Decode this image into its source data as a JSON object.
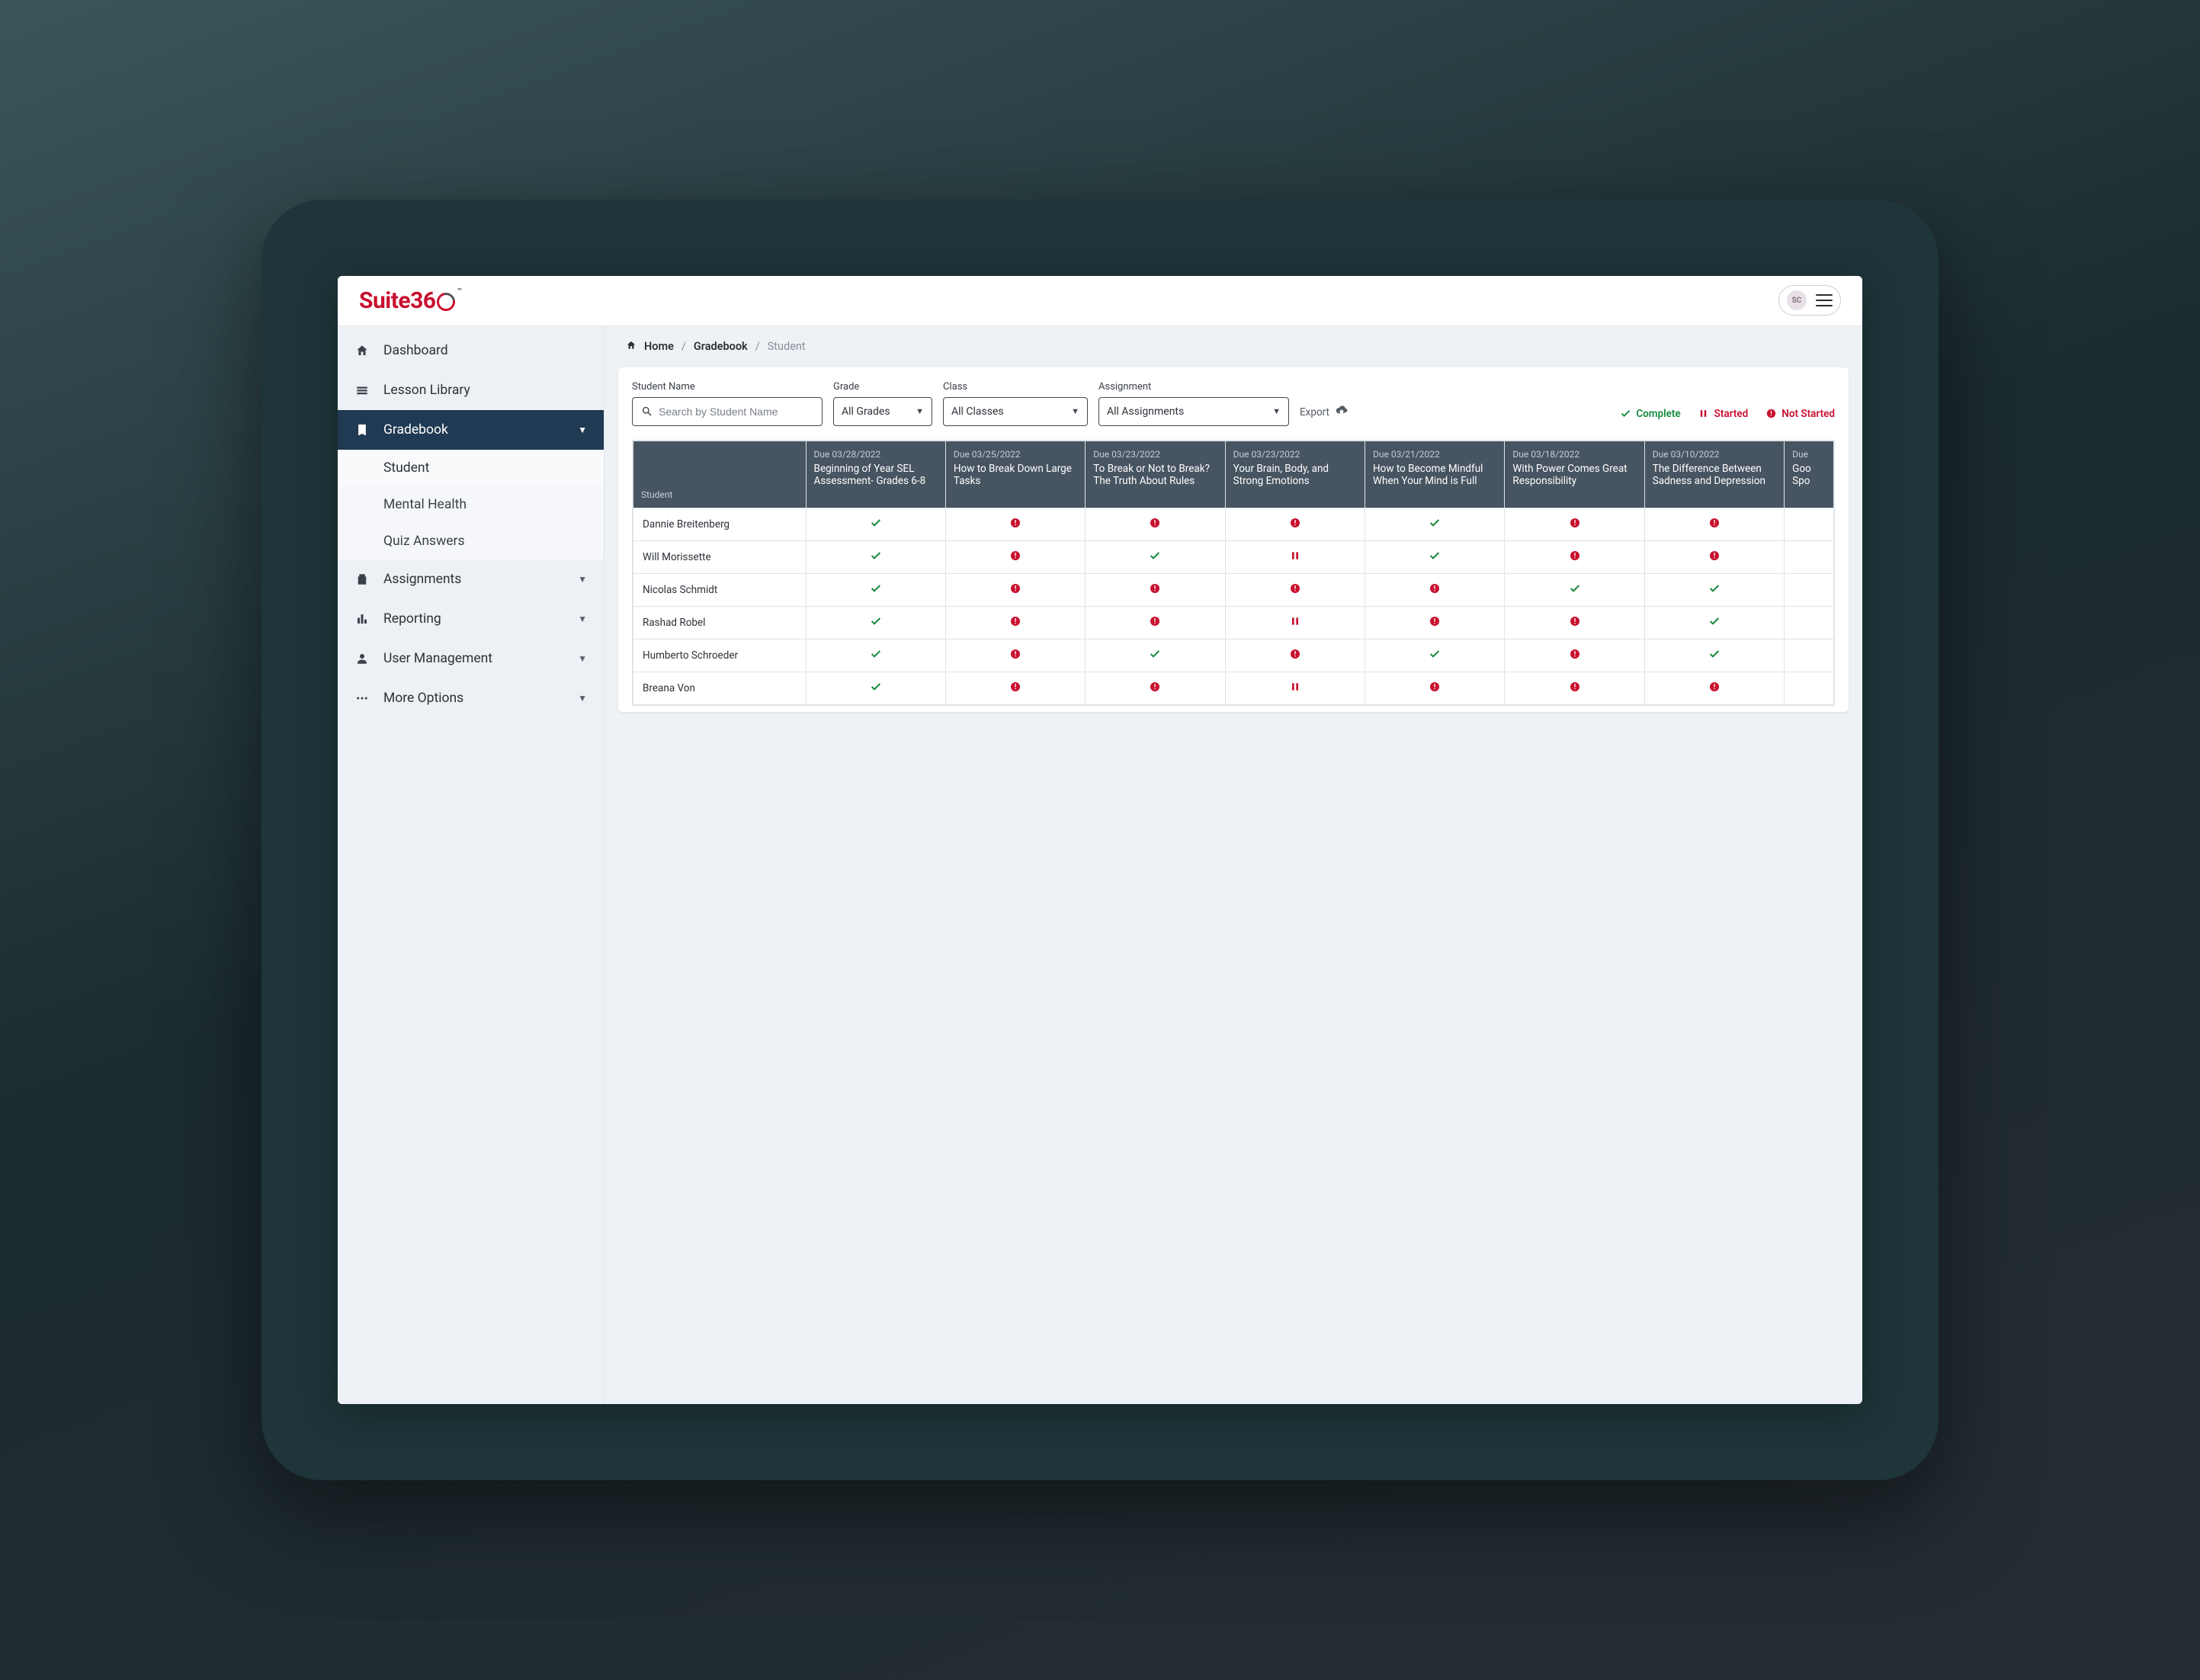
{
  "logo": {
    "part1": "Suite",
    "part2": "36"
  },
  "user": {
    "initials": "SC"
  },
  "sidebar": {
    "items": [
      {
        "label": "Dashboard",
        "icon": "home"
      },
      {
        "label": "Lesson Library",
        "icon": "library"
      },
      {
        "label": "Gradebook",
        "icon": "book",
        "active": true,
        "expandable": true,
        "children": [
          {
            "label": "Student",
            "active": true
          },
          {
            "label": "Mental Health"
          },
          {
            "label": "Quiz Answers"
          }
        ]
      },
      {
        "label": "Assignments",
        "icon": "clipboard",
        "expandable": true
      },
      {
        "label": "Reporting",
        "icon": "chart",
        "expandable": true
      },
      {
        "label": "User Management",
        "icon": "user",
        "expandable": true
      },
      {
        "label": "More Options",
        "icon": "dots",
        "expandable": true
      }
    ]
  },
  "breadcrumbs": {
    "home": "Home",
    "parent": "Gradebook",
    "current": "Student"
  },
  "filters": {
    "studentName": {
      "label": "Student Name",
      "placeholder": "Search by Student Name"
    },
    "grade": {
      "label": "Grade",
      "value": "All Grades"
    },
    "class": {
      "label": "Class",
      "value": "All Classes"
    },
    "assignment": {
      "label": "Assignment",
      "value": "All Assignments"
    },
    "exportLabel": "Export"
  },
  "legend": {
    "complete": "Complete",
    "started": "Started",
    "notStarted": "Not Started"
  },
  "table": {
    "studentHeader": "Student",
    "columns": [
      {
        "due": "Due 03/28/2022",
        "title": "Beginning of Year SEL Assessment- Grades 6-8"
      },
      {
        "due": "Due 03/25/2022",
        "title": "How to Break Down Large Tasks"
      },
      {
        "due": "Due 03/23/2022",
        "title": "To Break or Not to Break? The Truth About Rules"
      },
      {
        "due": "Due 03/23/2022",
        "title": "Your Brain, Body, and Strong Emotions"
      },
      {
        "due": "Due 03/21/2022",
        "title": "How to Become Mindful When Your Mind is Full"
      },
      {
        "due": "Due 03/18/2022",
        "title": "With Power Comes Great Responsibility"
      },
      {
        "due": "Due 03/10/2022",
        "title": "The Difference Between Sadness and Depression"
      },
      {
        "due": "Due",
        "title": "Goo Spo"
      }
    ],
    "rows": [
      {
        "name": "Dannie Breitenberg",
        "statuses": [
          "complete",
          "notstarted",
          "notstarted",
          "notstarted",
          "complete",
          "notstarted",
          "notstarted",
          ""
        ]
      },
      {
        "name": "Will Morissette",
        "statuses": [
          "complete",
          "notstarted",
          "complete",
          "started",
          "complete",
          "notstarted",
          "notstarted",
          ""
        ]
      },
      {
        "name": "Nicolas Schmidt",
        "statuses": [
          "complete",
          "notstarted",
          "notstarted",
          "notstarted",
          "notstarted",
          "complete",
          "complete",
          ""
        ]
      },
      {
        "name": "Rashad Robel",
        "statuses": [
          "complete",
          "notstarted",
          "notstarted",
          "started",
          "notstarted",
          "notstarted",
          "complete",
          ""
        ]
      },
      {
        "name": "Humberto Schroeder",
        "statuses": [
          "complete",
          "notstarted",
          "complete",
          "notstarted",
          "complete",
          "notstarted",
          "complete",
          ""
        ]
      },
      {
        "name": "Breana Von",
        "statuses": [
          "complete",
          "notstarted",
          "notstarted",
          "started",
          "notstarted",
          "notstarted",
          "notstarted",
          ""
        ]
      }
    ]
  }
}
